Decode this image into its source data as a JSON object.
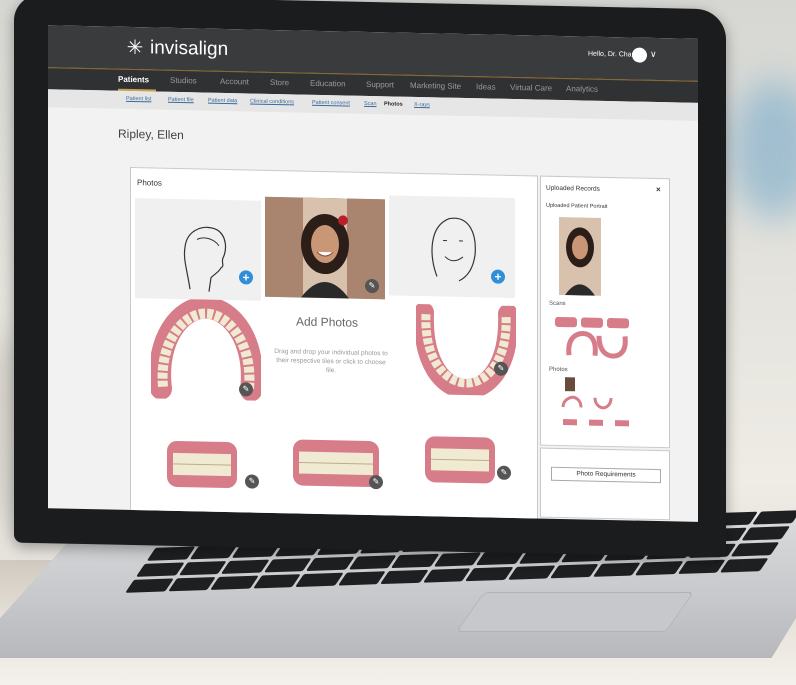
{
  "app": {
    "brand": "invisalign",
    "brand_mark": "sparkle-star-icon",
    "user_greeting": "Hello, Dr. Chang"
  },
  "nav": {
    "items": [
      "Patients",
      "Studios",
      "Account",
      "Store",
      "Education",
      "Support",
      "Marketing Site",
      "Ideas",
      "Virtual Care",
      "Analytics"
    ],
    "active": "Patients"
  },
  "breadcrumbs": [
    "Patient list",
    "Patient file",
    "Patient data",
    "Clinical conditions",
    "Patient consent",
    "Scan",
    "Photos",
    "X-rays"
  ],
  "patient": {
    "name": "Ripley, Ellen"
  },
  "photos_panel": {
    "title": "Photos",
    "add_title": "Add Photos",
    "add_desc": "Drag and drop your individual photos to their respective tiles or click to choose file."
  },
  "uploaded_records": {
    "title": "Uploaded Records",
    "close": "×",
    "subtitle": "Uploaded Patient Portrait",
    "sections": [
      "Scans",
      "Photos"
    ]
  },
  "photo_requirements": {
    "label": "Photo Requirements"
  },
  "colors": {
    "topbar": "#3a3b3d",
    "accent": "#c7a252",
    "plus_button": "#2f8fd8",
    "gum": "#d77d8a",
    "tooth": "#f1ead2"
  }
}
